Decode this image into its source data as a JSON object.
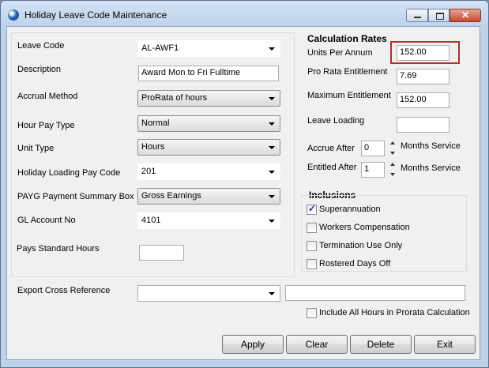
{
  "window": {
    "title": "Holiday Leave Code Maintenance"
  },
  "form": {
    "leave_code": {
      "label": "Leave Code",
      "value": "AL-AWF1"
    },
    "description": {
      "label": "Description",
      "value": "Award Mon to Fri Fulltime"
    },
    "accrual_method": {
      "label": "Accrual Method",
      "value": "ProRata of hours"
    },
    "hour_pay_type": {
      "label": "Hour Pay Type",
      "value": "Normal"
    },
    "unit_type": {
      "label": "Unit Type",
      "value": "Hours"
    },
    "holiday_loading_pay_code": {
      "label": "Holiday Loading Pay Code",
      "value": "201"
    },
    "payg_summary_box": {
      "label": "PAYG Payment Summary Box",
      "value": "Gross Earnings"
    },
    "gl_account_no": {
      "label": "GL Account No",
      "value": "4101"
    },
    "pays_standard_hours": {
      "label": "Pays Standard Hours",
      "value": ""
    },
    "export_cross_reference": {
      "label": "Export Cross Reference",
      "value": "",
      "value2": ""
    }
  },
  "calculation_rates": {
    "title": "Calculation Rates",
    "units_per_annum": {
      "label": "Units Per Annum",
      "value": "152.00"
    },
    "pro_rata_entitlement": {
      "label": "Pro Rata Entitlement",
      "value": "7.69"
    },
    "maximum_entitlement": {
      "label": "Maximum Entitlement",
      "value": "152.00"
    },
    "leave_loading": {
      "label": "Leave Loading",
      "value": ""
    },
    "accrue_after": {
      "label": "Accrue After",
      "value": "0",
      "suffix": "Months Service"
    },
    "entitled_after": {
      "label": "Entitled After",
      "value": "1",
      "suffix": "Months Service"
    }
  },
  "inclusions": {
    "title": "Inclusions",
    "items": [
      {
        "label": "Superannuation",
        "checked": true
      },
      {
        "label": "Workers Compensation",
        "checked": false
      },
      {
        "label": "Termination Use Only",
        "checked": false
      },
      {
        "label": "Rostered Days Off",
        "checked": false
      }
    ]
  },
  "include_all_hours": {
    "label": "Include All Hours in Prorata Calculation",
    "checked": false
  },
  "buttons": {
    "apply": "Apply",
    "clear": "Clear",
    "delete": "Delete",
    "exit": "Exit"
  },
  "colors": {
    "highlight": "#b03030",
    "title_bar": "#c9dcf0",
    "close_button": "#c7472f"
  }
}
